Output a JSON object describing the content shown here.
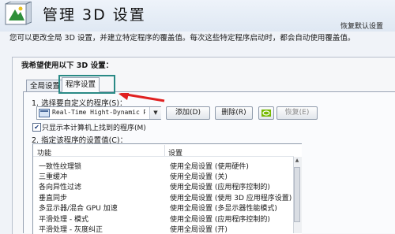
{
  "header": {
    "title": "管理 3D 设置",
    "restore_defaults": "恢复默认设置"
  },
  "description": "您可以更改全局 3D 设置，并建立特定程序的覆盖值。每次这些特定程序启动时，都会自动使用覆盖值。",
  "panel": {
    "title": "我希望使用以下 3D 设置：",
    "tabs": [
      {
        "label": "全局设置"
      },
      {
        "label": "程序设置"
      }
    ]
  },
  "program_settings": {
    "step1_label": "1. 选择要自定义的程序(S)：",
    "selected_program": "Real-Time Hight-Dynamic Ran",
    "add_button": "添加(D)",
    "delete_button": "删除(R)",
    "restore_button": "恢复(E)",
    "only_show_checkbox": "只显示本计算机上找到的程序(M)",
    "step2_label": "2. 指定该程序的设置值(C)："
  },
  "table": {
    "headers": {
      "feature": "功能",
      "setting": "设置"
    },
    "rows": [
      {
        "feature": "一致性纹理锁",
        "setting": "使用全局设置 (使用硬件)"
      },
      {
        "feature": "三重缓冲",
        "setting": "使用全局设置 (关)"
      },
      {
        "feature": "各向异性过滤",
        "setting": "使用全局设置 (应用程序控制的)"
      },
      {
        "feature": "垂直同步",
        "setting": "使用全局设置 (使用 3D 应用程序设置)"
      },
      {
        "feature": "多显示器/混合 GPU 加速",
        "setting": "使用全局设置 (多显示器性能模式)"
      },
      {
        "feature": "平滑处理 - 模式",
        "setting": "使用全局设置 (应用程序控制的)"
      },
      {
        "feature": "平滑处理 - 灰度纠正",
        "setting": "使用全局设置 (开)"
      }
    ]
  },
  "colors": {
    "highlight_box": "#2a8a86",
    "annotation_arrow": "#e02020",
    "nvidia_green": "#76b900"
  }
}
